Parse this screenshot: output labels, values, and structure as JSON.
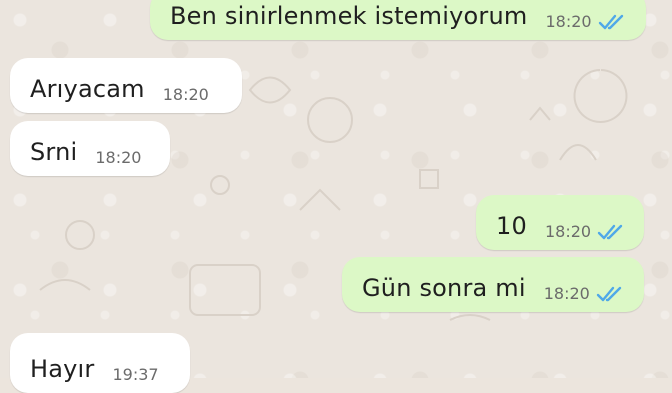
{
  "messages": [
    {
      "id": "m1",
      "direction": "outgoing",
      "text": "Ben sinirlenmek istemiyorum",
      "time": "18:20",
      "status_icon": "double-check-read-icon"
    },
    {
      "id": "m2",
      "direction": "incoming",
      "text": "Arıyacam",
      "time": "18:20"
    },
    {
      "id": "m3",
      "direction": "incoming",
      "text": "Srni",
      "time": "18:20"
    },
    {
      "id": "m4",
      "direction": "outgoing",
      "text": "10",
      "time": "18:20",
      "status_icon": "double-check-read-icon"
    },
    {
      "id": "m5",
      "direction": "outgoing",
      "text": "Gün sonra mi",
      "time": "18:20",
      "status_icon": "double-check-read-icon"
    },
    {
      "id": "m6",
      "direction": "incoming",
      "text": "Hayır",
      "time": "19:37"
    }
  ],
  "colors": {
    "background": "#ebe5de",
    "incoming_bubble": "#ffffff",
    "outgoing_bubble": "#dcf8c6",
    "read_ticks": "#4fa8e8",
    "time_text": "#6b6b6b"
  }
}
